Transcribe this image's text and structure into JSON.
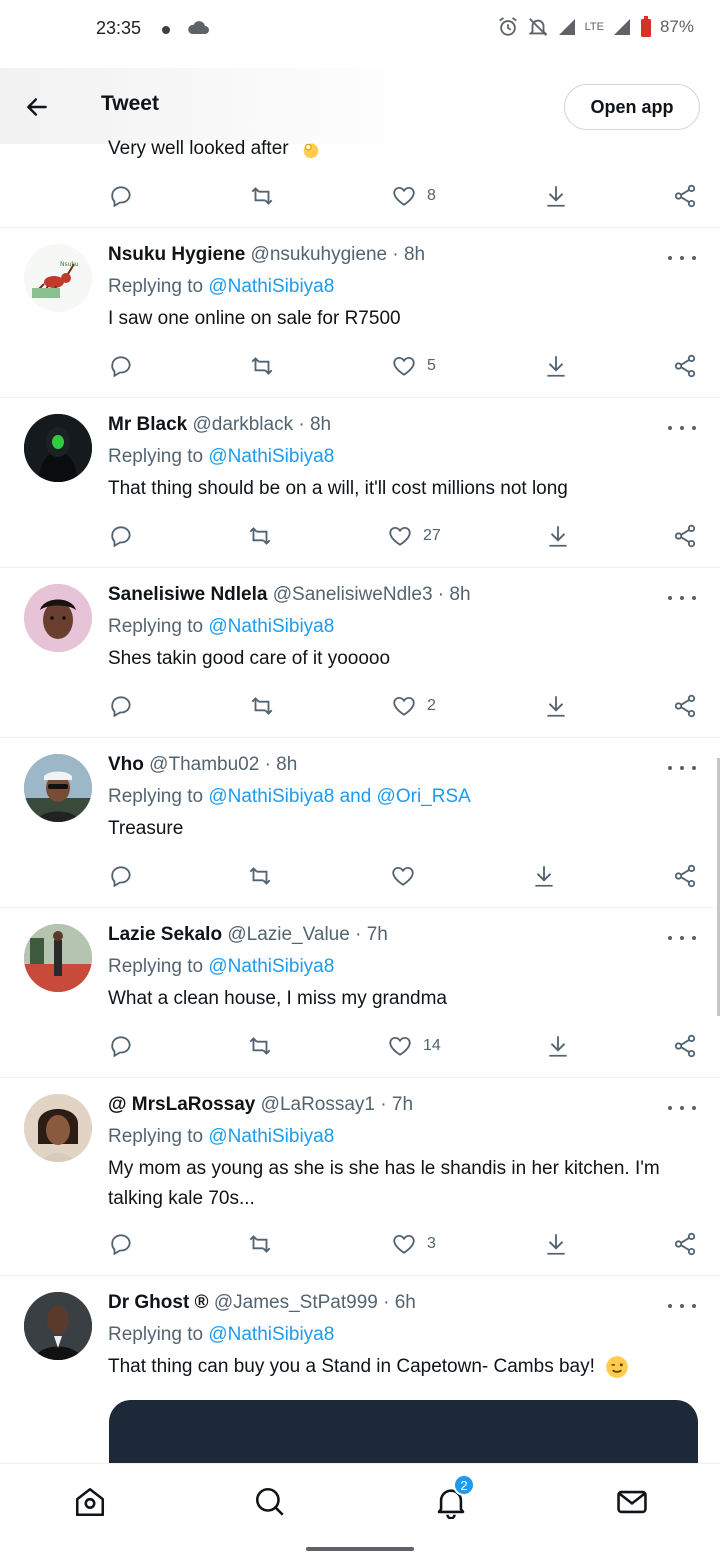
{
  "status_bar": {
    "time": "23:35",
    "battery": "87%",
    "network": "LTE"
  },
  "header": {
    "title": "Tweet",
    "open_app": "Open app"
  },
  "partial_tweet": {
    "text": "Very well looked after",
    "likes": "8"
  },
  "tweets": [
    {
      "name": "Nsuku Hygiene",
      "handle": "@nsukuhygiene · 8h",
      "reply_prefix": "Replying to ",
      "mentions": "@NathiSibiya8",
      "text": "I saw one online on sale for R7500",
      "likes": "5"
    },
    {
      "name": "Mr Black",
      "handle": "@darkblack · 8h",
      "reply_prefix": "Replying to ",
      "mentions": "@NathiSibiya8",
      "text": "That thing should be on a will, it'll cost millions not long",
      "likes": "27"
    },
    {
      "name": "Sanelisiwe Ndlela",
      "handle": "@SanelisiweNdle3 · 8h",
      "reply_prefix": "Replying to ",
      "mentions": "@NathiSibiya8",
      "text": "Shes takin good care of it yooooo",
      "likes": "2"
    },
    {
      "name": "Vho",
      "handle": "@Thambu02 · 8h",
      "reply_prefix": "Replying to ",
      "mentions": "@NathiSibiya8 and @Ori_RSA",
      "text": "Treasure",
      "likes": ""
    },
    {
      "name": "Lazie Sekalo",
      "handle": "@Lazie_Value · 7h",
      "reply_prefix": "Replying to ",
      "mentions": "@NathiSibiya8",
      "text": "What a clean house, I miss my grandma",
      "likes": "14"
    },
    {
      "name": "@ MrsLaRossay",
      "handle": "@LaRossay1 · 7h",
      "reply_prefix": "Replying to ",
      "mentions": "@NathiSibiya8",
      "text": "My mom as young as she is she has le shandis in her kitchen. I'm talking kale 70s...",
      "likes": "3"
    },
    {
      "name": "Dr Ghost ®",
      "handle": "@James_StPat999 · 6h",
      "reply_prefix": "Replying to ",
      "mentions": "@NathiSibiya8",
      "text": "That thing can buy you a Stand in Capetown- Cambs bay!",
      "likes": ""
    }
  ],
  "bottom_nav": {
    "notification_count": "2"
  },
  "colors": {
    "accent": "#1d9bf0",
    "text": "#0f1419",
    "secondary": "#536471"
  }
}
